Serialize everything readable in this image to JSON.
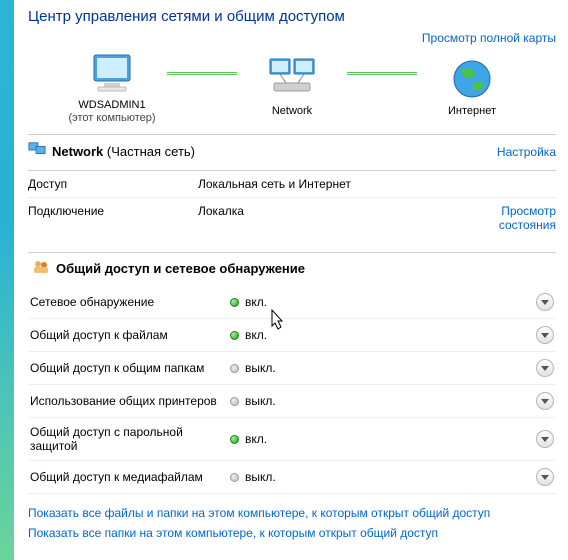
{
  "page_title": "Центр управления сетями и общим доступом",
  "view_full_map": "Просмотр полной карты",
  "map": {
    "node_pc": "WDSADMIN1",
    "node_pc_sub": "(этот компьютер)",
    "node_network": "Network",
    "node_internet": "Интернет"
  },
  "network": {
    "name": "Network",
    "type": "(Частная сеть)",
    "settings": "Настройка",
    "rows": [
      {
        "label": "Доступ",
        "value": "Локальная сеть и Интернет",
        "link": ""
      },
      {
        "label": "Подключение",
        "value": "Локалка",
        "link": "Просмотр состояния"
      }
    ]
  },
  "sharing": {
    "title": "Общий доступ и сетевое обнаружение",
    "on_text": "вкл.",
    "off_text": "выкл.",
    "items": [
      {
        "label": "Сетевое обнаружение",
        "on": true
      },
      {
        "label": "Общий доступ к файлам",
        "on": true
      },
      {
        "label": "Общий доступ к общим папкам",
        "on": false
      },
      {
        "label": "Использование общих принтеров",
        "on": false
      },
      {
        "label": "Общий доступ с парольной защитой",
        "on": true
      },
      {
        "label": "Общий доступ к медиафайлам",
        "on": false
      }
    ]
  },
  "footer_links": [
    "Показать все файлы и папки на этом компьютере, к которым открыт общий доступ",
    "Показать все папки на этом компьютере, к которым открыт общий доступ"
  ]
}
